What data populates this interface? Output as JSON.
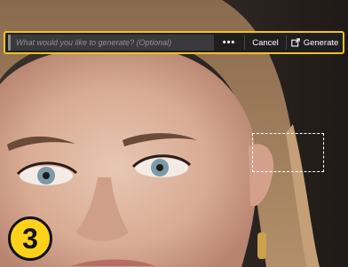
{
  "generate_bar": {
    "prompt_placeholder": "What would you like to generate? (Optional)",
    "prompt_value": "",
    "more_label": "•••",
    "cancel_label": "Cancel",
    "generate_label": "Generate",
    "generate_icon": "generate-icon",
    "highlight_color": "#f2c21b"
  },
  "step_badge": {
    "number": "3",
    "color": "#ffd21a"
  },
  "selection": {
    "style": "dashed marquee"
  }
}
